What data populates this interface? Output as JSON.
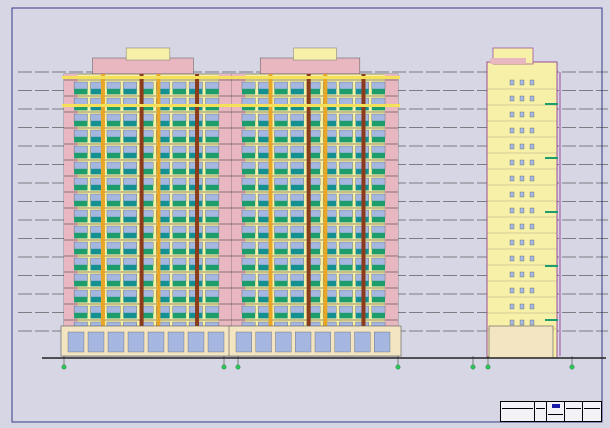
{
  "drawing": {
    "type": "cad-elevation",
    "background": "#d6d6e4",
    "border_color": "#3a3a8a",
    "colors": {
      "facade": "#f7f0a8",
      "balcony_green": "#1d9c6c",
      "balcony_teal": "#159090",
      "pink_trim": "#e9b7c0",
      "window_blue": "#a5b7e0",
      "brown_column": "#8a3c1c",
      "orange_column": "#e8a628",
      "floor_line": "#2a2a2a",
      "grid_line": "#8a2a8a",
      "marker_green": "#2ec85a",
      "ground": "#222222"
    },
    "icons": [
      "axis-marker-icon"
    ]
  },
  "title_block": {
    "firm": "",
    "fields": [
      "",
      "",
      "",
      ""
    ]
  }
}
